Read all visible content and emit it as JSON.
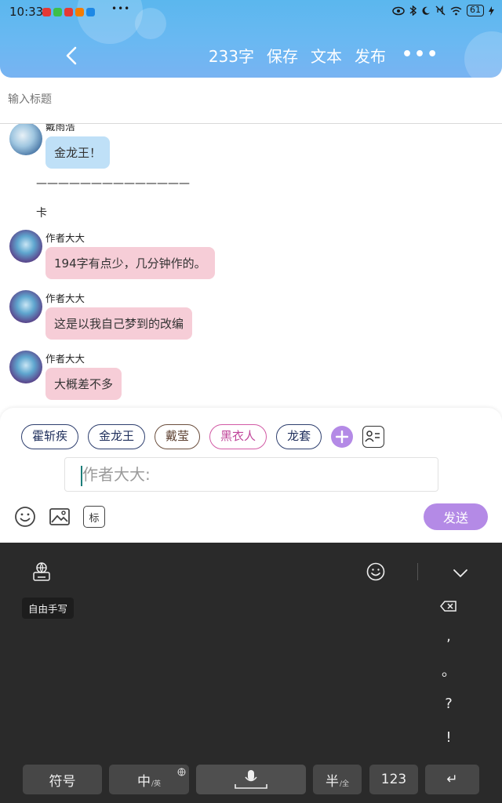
{
  "status_bar": {
    "time": "10:33",
    "battery": "61"
  },
  "header": {
    "word_count": "233字",
    "save_label": "保存",
    "text_label": "文本",
    "publish_label": "发布",
    "more_label": "•••",
    "gradient_colors": [
      "#5bb7ee",
      "#78b3f2"
    ]
  },
  "title": {
    "placeholder": "输入标题"
  },
  "chat": {
    "messages": [
      {
        "name": "戴雨浩",
        "text": "金龙王！",
        "color": "blue"
      },
      {
        "divider": "——————————————"
      },
      {
        "plain": "卡"
      },
      {
        "name": "作者大大",
        "text": "194字有点少，几分钟作的。",
        "color": "pink"
      },
      {
        "name": "作者大大",
        "text": "这是以我自己梦到的改编",
        "color": "pink"
      },
      {
        "name": "作者大大",
        "text": "大概差不多",
        "color": "pink"
      }
    ]
  },
  "composer": {
    "characters": [
      "霍斩疾",
      "金龙王",
      "戴莹",
      "黑衣人",
      "龙套"
    ],
    "input_placeholder": "作者大大:",
    "tag_label": "标",
    "send_label": "发送",
    "accent_color": "#b48ae6"
  },
  "keyboard": {
    "handwrite_label": "自由手写",
    "side_keys": [
      ",",
      "。",
      "?",
      "!"
    ],
    "symbols_label": "符号",
    "chinese_label": "中",
    "chinese_sub": "/英",
    "half_label": "半",
    "half_sub": "/全",
    "num_label": "123",
    "enter_label": "↵"
  }
}
